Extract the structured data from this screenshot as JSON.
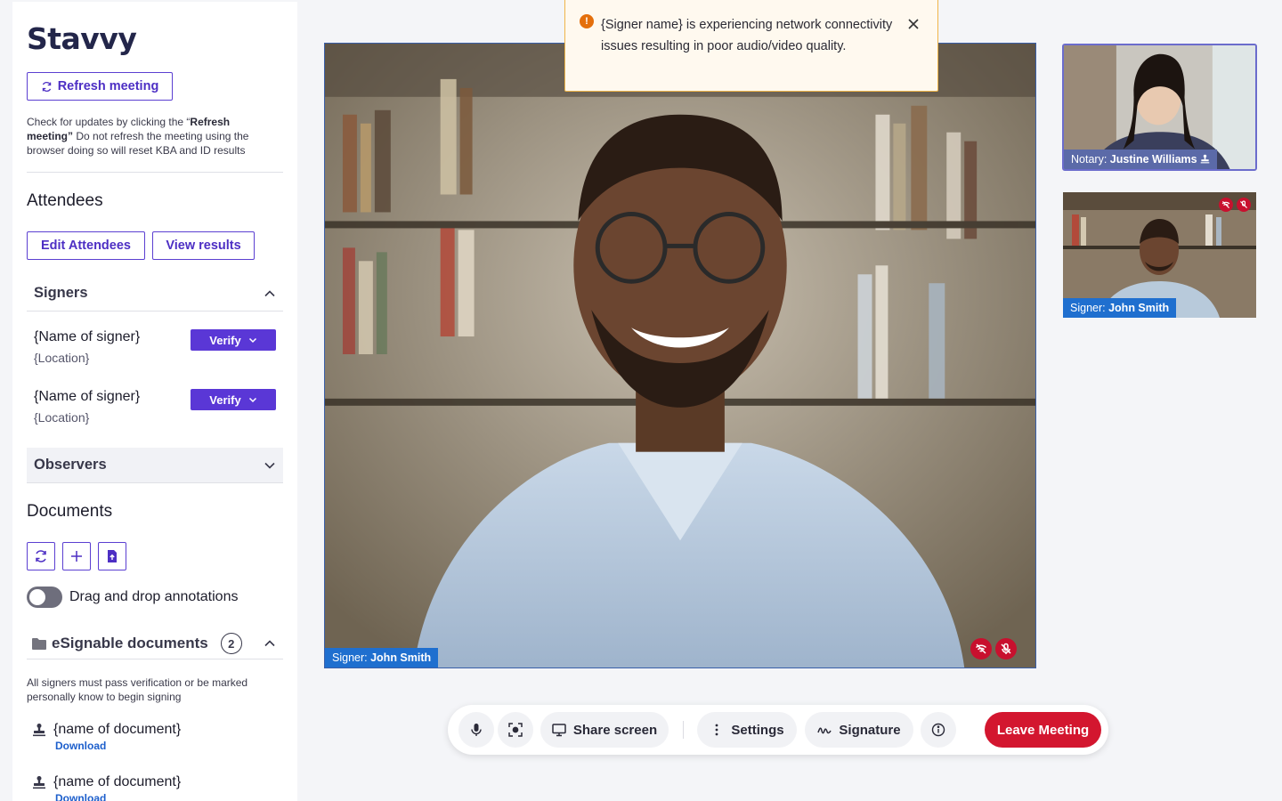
{
  "brand": {
    "logo": "Stavvy",
    "accent": "#5a37d6",
    "danger": "#d3162f",
    "link": "#1d5fcc"
  },
  "sidebar": {
    "refresh_label": "Refresh meeting",
    "helper_pre": "Check for updates by clicking the “",
    "helper_bold": "Refresh meeting”",
    "helper_post": "  Do not refresh the meeting using the browser doing so will reset KBA and ID results",
    "attendees_title": "Attendees",
    "edit_attendees_label": "Edit Attendees",
    "view_results_label": "View results",
    "signers_title": "Signers",
    "signers": [
      {
        "name": "{Name of signer}",
        "location": "{Location}",
        "verify_label": "Verify"
      },
      {
        "name": "{Name of signer}",
        "location": "{Location}",
        "verify_label": "Verify"
      }
    ],
    "observers_title": "Observers",
    "documents_title": "Documents",
    "drag_drop_label": "Drag and drop annotations",
    "drag_drop_enabled": false,
    "esignable_title": "eSignable documents",
    "esignable_count": "2",
    "esignable_note": "All signers must pass verification or be marked personally know to begin signing",
    "documents": [
      {
        "name": "{name of document}",
        "action": "Download"
      },
      {
        "name": "{name of document}",
        "action": "Download"
      }
    ]
  },
  "toast": {
    "message": "{Signer name} is experiencing network connectivity issues resulting in poor audio/video quality.",
    "icon": "alert-icon"
  },
  "main_video": {
    "role": "Signer:",
    "name": "John Smith"
  },
  "thumbnails": [
    {
      "role": "Notary:",
      "name": "Justine Williams"
    },
    {
      "role": "Signer:",
      "name": "John Smith"
    }
  ],
  "controls": {
    "mic_icon": "microphone-icon",
    "camera_icon": "camera-focus-icon",
    "share_label": "Share screen",
    "settings_label": "Settings",
    "signature_label": "Signature",
    "info_icon": "info-icon",
    "leave_label": "Leave Meeting"
  }
}
